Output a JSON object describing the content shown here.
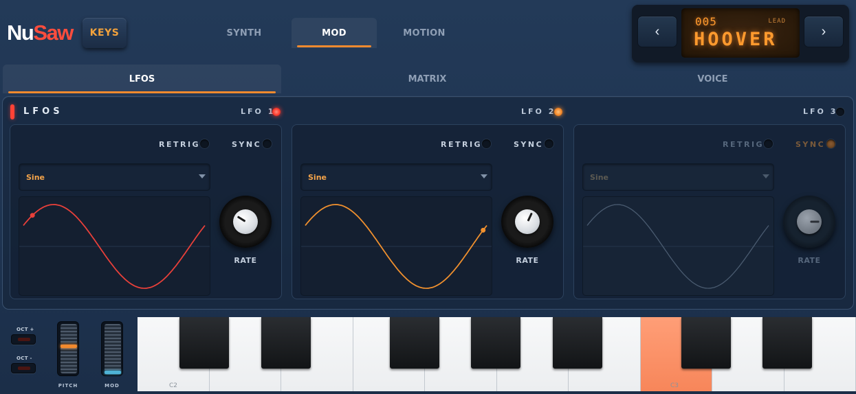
{
  "brand": {
    "nu": "Nu",
    "saw": "Saw"
  },
  "header": {
    "keys_label": "KEYS",
    "tabs": [
      {
        "label": "SYNTH",
        "active": false
      },
      {
        "label": "MOD",
        "active": true
      },
      {
        "label": "MOTION",
        "active": false
      }
    ]
  },
  "preset": {
    "number": "005",
    "category": "LEAD",
    "name": "HOOVER",
    "prev_icon": "‹",
    "next_icon": "›"
  },
  "sub_tabs": [
    {
      "label": "LFOS",
      "active": true
    },
    {
      "label": "MATRIX",
      "active": false
    },
    {
      "label": "VOICE",
      "active": false
    }
  ],
  "lfo_section": {
    "title": "LFOS",
    "lfos": [
      {
        "label": "LFO 1",
        "led_color": "#ff3b2f",
        "wave_color": "#e8403a",
        "retrig": "RETRIG",
        "sync": "SYNC",
        "shape": "Sine",
        "rate_label": "RATE",
        "phase": 0.05,
        "enabled": true
      },
      {
        "label": "LFO 2",
        "led_color": "#f58a2b",
        "wave_color": "#f0902e",
        "retrig": "RETRIG",
        "sync": "SYNC",
        "shape": "Sine",
        "rate_label": "RATE",
        "phase": 0.98,
        "enabled": true
      },
      {
        "label": "LFO 3",
        "led_color": "#0d1520",
        "wave_color": "#4a5b70",
        "retrig": "RETRIG",
        "sync": "SYNC",
        "shape": "Sine",
        "rate_label": "RATE",
        "phase": null,
        "enabled": false
      }
    ]
  },
  "performance": {
    "oct_up": "OCT +",
    "oct_down": "OCT -",
    "pitch_label": "PITCH",
    "mod_label": "MOD",
    "pitch_color": "#f28a2e",
    "mod_color": "#4fb3d6"
  },
  "keyboard": {
    "labels": {
      "c2": "C2",
      "c3": "C3"
    },
    "highlight_color": "#f7865a"
  }
}
